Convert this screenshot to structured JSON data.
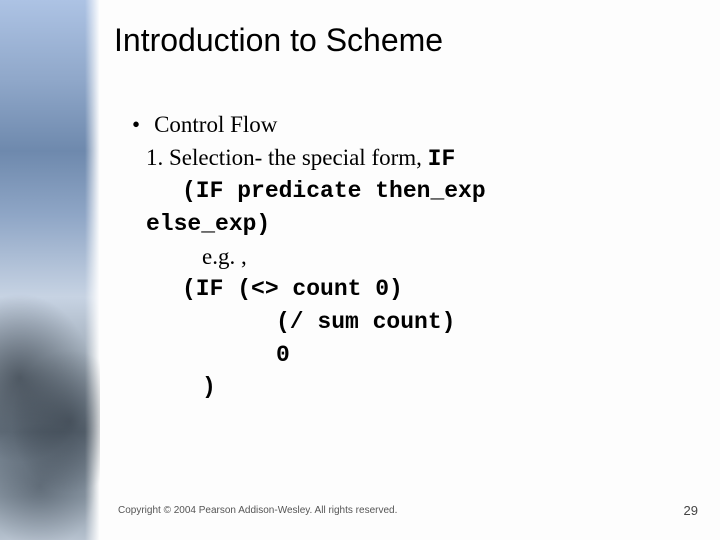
{
  "title": "Introduction to Scheme",
  "bullet": "Control Flow",
  "line1_a": "1. Selection- the special form, ",
  "line1_b": "IF",
  "code1": "(IF predicate then_exp",
  "code2": "else_exp)",
  "eg": "e.g. ,",
  "code3": "(IF (<> count 0)",
  "code4": "(/ sum count)",
  "code5": "0",
  "code6": ")",
  "footer": "Copyright © 2004 Pearson Addison-Wesley. All rights reserved.",
  "page": "29"
}
